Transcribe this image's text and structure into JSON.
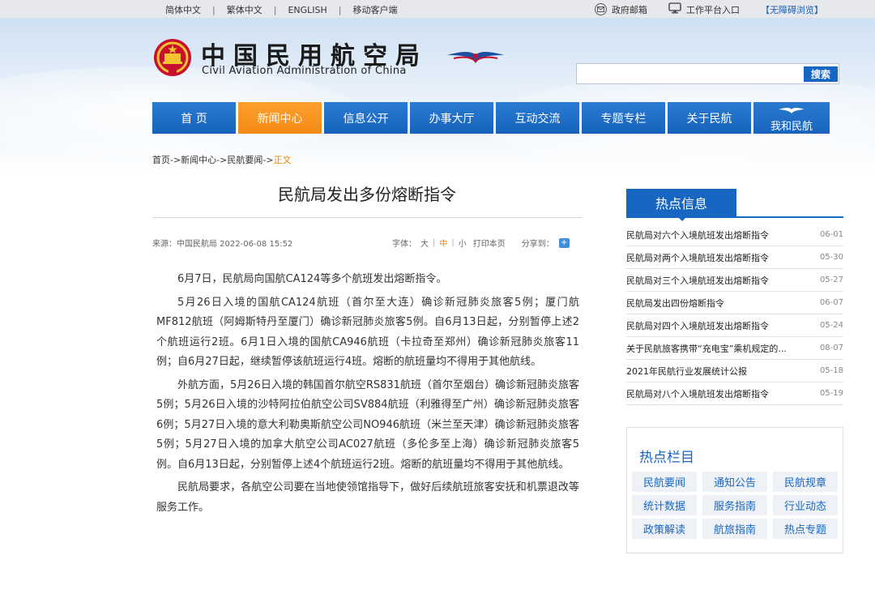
{
  "topbar": {
    "langs": [
      "简体中文",
      "繁体中文",
      "ENGLISH",
      "移动客户端"
    ],
    "mail_label": "政府邮箱",
    "work_label": "工作平台入口",
    "access_label": "【无障碍浏览】"
  },
  "header": {
    "logo_cn": "中国民用航空局",
    "logo_en": "Civil Aviation Administration of China",
    "search_placeholder": "",
    "search_label": "搜索"
  },
  "nav": {
    "items": [
      "首 页",
      "新闻中心",
      "信息公开",
      "办事大厅",
      "互动交流",
      "专题专栏",
      "关于民航"
    ],
    "special": "我和民航"
  },
  "breadcrumb": {
    "path": "首页->新闻中心->民航要闻->",
    "current": "正文"
  },
  "article": {
    "title": "民航局发出多份熔断指令",
    "source": "来源：中国民航局  2022-06-08 15:52",
    "font_label": "字体：",
    "size_large": "大",
    "size_mid": "中",
    "size_small": "小",
    "print_label": "打印本页",
    "share_label": "分享到：",
    "paragraphs": [
      "6月7日，民航局向国航CA124等多个航班发出熔断指令。",
      "5月26日入境的国航CA124航班（首尔至大连）确诊新冠肺炎旅客5例；厦门航MF812航班（阿姆斯特丹至厦门）确诊新冠肺炎旅客5例。自6月13日起，分别暂停上述2个航班运行2班。6月1日入境的国航CA946航班（卡拉奇至郑州）确诊新冠肺炎旅客11例；自6月27日起，继续暂停该航班运行4班。熔断的航班量均不得用于其他航线。",
      "外航方面，5月26日入境的韩国首尔航空RS831航班（首尔至烟台）确诊新冠肺炎旅客5例；5月26日入境的沙特阿拉伯航空公司SV884航班（利雅得至广州）确诊新冠肺炎旅客6例；5月27日入境的意大利勒奥斯航空公司NO946航班（米兰至天津）确诊新冠肺炎旅客5例；5月27日入境的加拿大航空公司AC027航班（多伦多至上海）确诊新冠肺炎旅客5例。自6月13日起，分别暂停上述4个航班运行2班。熔断的航班量均不得用于其他航线。",
      "民航局要求，各航空公司要在当地使领馆指导下，做好后续航班旅客安抚和机票退改等服务工作。"
    ]
  },
  "hot_info": {
    "title": "热点信息",
    "items": [
      {
        "title": "民航局对六个入境航班发出熔断指令",
        "date": "06-01"
      },
      {
        "title": "民航局对两个入境航班发出熔断指令",
        "date": "05-30"
      },
      {
        "title": "民航局对三个入境航班发出熔断指令",
        "date": "05-27"
      },
      {
        "title": "民航局发出四份熔断指令",
        "date": "06-07"
      },
      {
        "title": "民航局对四个入境航班发出熔断指令",
        "date": "05-24"
      },
      {
        "title": "关于民航旅客携带“充电宝”乘机规定的...",
        "date": "08-07"
      },
      {
        "title": "2021年民航行业发展统计公报",
        "date": "05-18"
      },
      {
        "title": "民航局对八个入境航班发出熔断指令",
        "date": "05-19"
      }
    ]
  },
  "hot_columns": {
    "title": "热点栏目",
    "items": [
      "民航要闻",
      "通知公告",
      "民航规章",
      "统计数据",
      "服务指南",
      "行业动态",
      "政策解读",
      "航旅指南",
      "热点专题"
    ]
  },
  "colors": {
    "brand_blue": "#1766c2",
    "active_orange": "#f28a14"
  }
}
